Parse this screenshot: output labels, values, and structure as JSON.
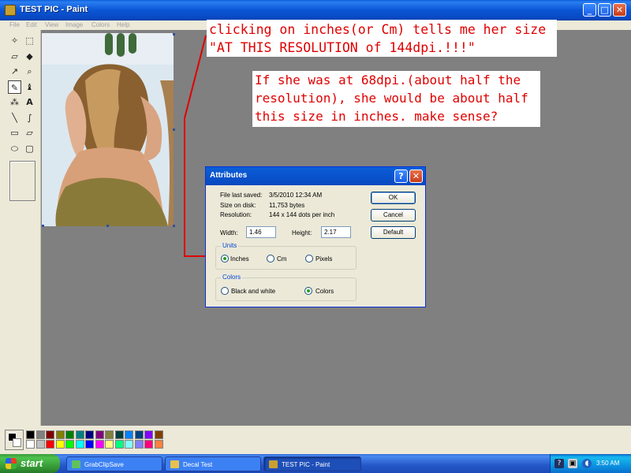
{
  "window": {
    "title": "TEST PIC - Paint",
    "minimize": "_",
    "maximize": "□",
    "close": "✕"
  },
  "menu": [
    "File",
    "Edit",
    "View",
    "Image",
    "Colors",
    "Help"
  ],
  "tools": [
    {
      "name": "free-form-select-icon",
      "glyph": "✧"
    },
    {
      "name": "select-icon",
      "glyph": "⬚"
    },
    {
      "name": "eraser-icon",
      "glyph": "▱"
    },
    {
      "name": "fill-icon",
      "glyph": "◆"
    },
    {
      "name": "pick-color-icon",
      "glyph": "↗"
    },
    {
      "name": "magnifier-icon",
      "glyph": "⌕"
    },
    {
      "name": "pencil-icon",
      "glyph": "✎"
    },
    {
      "name": "brush-icon",
      "glyph": "♝"
    },
    {
      "name": "airbrush-icon",
      "glyph": "⁂"
    },
    {
      "name": "text-icon",
      "glyph": "A"
    },
    {
      "name": "line-icon",
      "glyph": "╲"
    },
    {
      "name": "curve-icon",
      "glyph": "∫"
    },
    {
      "name": "rectangle-icon",
      "glyph": "▭"
    },
    {
      "name": "polygon-icon",
      "glyph": "▱"
    },
    {
      "name": "ellipse-icon",
      "glyph": "⬭"
    },
    {
      "name": "rounded-rectangle-icon",
      "glyph": "▢"
    }
  ],
  "annotations": {
    "note1_line1": "clicking on inches(or Cm) tells me her size",
    "note1_line2": "\"AT THIS RESOLUTION of 144dpi.!!!\"",
    "note2_line1": "If she was at 68dpi.(about half the",
    "note2_line2": "resolution), she would be about half",
    "note2_line3": "this size in inches. make sense?"
  },
  "dialog": {
    "title": "Attributes",
    "help": "?",
    "close": "✕",
    "file_last_saved_label": "File last saved:",
    "file_last_saved": "3/5/2010 12:34 AM",
    "size_on_disk_label": "Size on disk:",
    "size_on_disk": "11,753 bytes",
    "resolution_label": "Resolution:",
    "resolution": "144 x 144 dots per inch",
    "width_label": "Width:",
    "width": "1.46",
    "height_label": "Height:",
    "height": "2.17",
    "units_label": "Units",
    "unit_inches": "Inches",
    "unit_cm": "Cm",
    "unit_pixels": "Pixels",
    "colors_label": "Colors",
    "color_bw": "Black and white",
    "color_colors": "Colors",
    "ok": "OK",
    "cancel": "Cancel",
    "default": "Default"
  },
  "palette": {
    "row1": [
      "#000000",
      "#808080",
      "#800000",
      "#808000",
      "#008000",
      "#008080",
      "#000080",
      "#800080",
      "#808040",
      "#004040",
      "#0080ff",
      "#004080",
      "#8000ff",
      "#804000"
    ],
    "row2": [
      "#ffffff",
      "#c0c0c0",
      "#ff0000",
      "#ffff00",
      "#00ff00",
      "#00ffff",
      "#0000ff",
      "#ff00ff",
      "#ffff80",
      "#00ff80",
      "#80ffff",
      "#8080ff",
      "#ff0080",
      "#ff8040"
    ]
  },
  "taskbar": {
    "start": "start",
    "tasks": [
      "GrabClipSave",
      "Decal Test",
      "TEST PIC - Paint"
    ],
    "clock": "3:50 AM",
    "help_icon": "?"
  }
}
